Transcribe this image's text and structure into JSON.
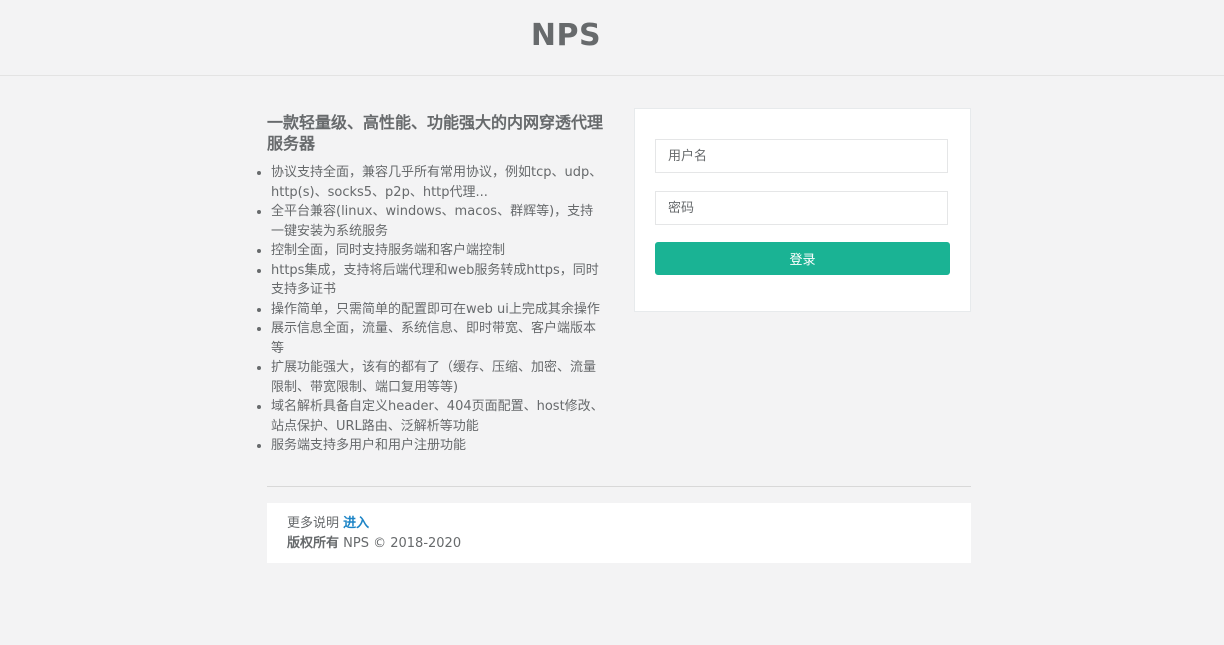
{
  "header": {
    "title": "NPS"
  },
  "intro": {
    "tagline": "一款轻量级、高性能、功能强大的内网穿透代理服务器",
    "features": [
      "协议支持全面，兼容几乎所有常用协议，例如tcp、udp、http(s)、socks5、p2p、http代理...",
      "全平台兼容(linux、windows、macos、群辉等)，支持一键安装为系统服务",
      "控制全面，同时支持服务端和客户端控制",
      "https集成，支持将后端代理和web服务转成https，同时支持多证书",
      "操作简单，只需简单的配置即可在web ui上完成其余操作",
      "展示信息全面，流量、系统信息、即时带宽、客户端版本等",
      "扩展功能强大，该有的都有了（缓存、压缩、加密、流量限制、带宽限制、端口复用等等)",
      "域名解析具备自定义header、404页面配置、host修改、站点保护、URL路由、泛解析等功能",
      "服务端支持多用户和用户注册功能"
    ]
  },
  "login": {
    "username_placeholder": "用户名",
    "username_value": "",
    "password_placeholder": "密码",
    "password_value": "",
    "submit_label": "登录"
  },
  "footer": {
    "more_label": "更多说明",
    "more_link": "进入",
    "copyright_label": "版权所有",
    "copyright_text": "NPS © 2018-2020"
  },
  "colors": {
    "accent": "#1ab394",
    "link": "#1c84c6",
    "background": "#f3f3f4",
    "text": "#676a6c"
  }
}
